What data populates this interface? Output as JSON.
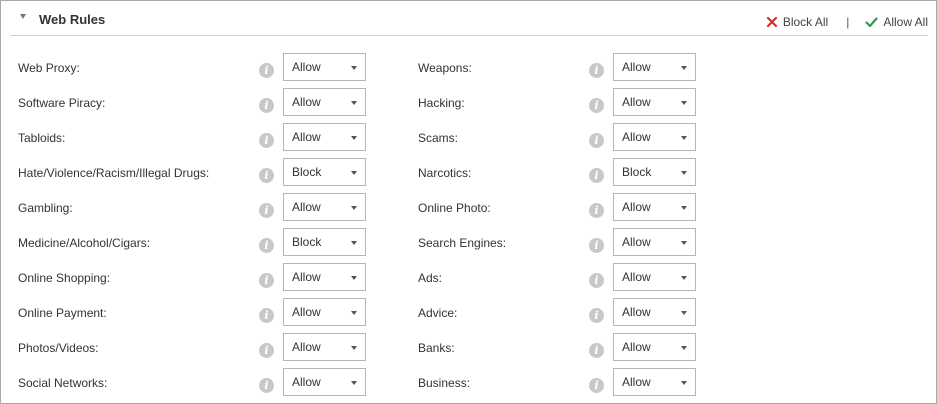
{
  "panel": {
    "title": "Web Rules",
    "actions": {
      "block_all": "Block All",
      "separator": "|",
      "allow_all": "Allow All"
    }
  },
  "colors": {
    "block_icon": "#d32f2f",
    "allow_icon": "#2e9d4b",
    "info_icon": "#c8c8c8"
  },
  "rules_left": [
    {
      "label": "Web Proxy:",
      "value": "Allow"
    },
    {
      "label": "Software Piracy:",
      "value": "Allow"
    },
    {
      "label": "Tabloids:",
      "value": "Allow"
    },
    {
      "label": "Hate/Violence/Racism/Illegal Drugs:",
      "value": "Block"
    },
    {
      "label": "Gambling:",
      "value": "Allow"
    },
    {
      "label": "Medicine/Alcohol/Cigars:",
      "value": "Block"
    },
    {
      "label": "Online Shopping:",
      "value": "Allow"
    },
    {
      "label": "Online Payment:",
      "value": "Allow"
    },
    {
      "label": "Photos/Videos:",
      "value": "Allow"
    },
    {
      "label": "Social Networks:",
      "value": "Allow"
    }
  ],
  "rules_right": [
    {
      "label": "Weapons:",
      "value": "Allow"
    },
    {
      "label": "Hacking:",
      "value": "Allow"
    },
    {
      "label": "Scams:",
      "value": "Allow"
    },
    {
      "label": "Narcotics:",
      "value": "Block"
    },
    {
      "label": "Online Photo:",
      "value": "Allow"
    },
    {
      "label": "Search Engines:",
      "value": "Allow"
    },
    {
      "label": "Ads:",
      "value": "Allow"
    },
    {
      "label": "Advice:",
      "value": "Allow"
    },
    {
      "label": "Banks:",
      "value": "Allow"
    },
    {
      "label": "Business:",
      "value": "Allow"
    }
  ]
}
